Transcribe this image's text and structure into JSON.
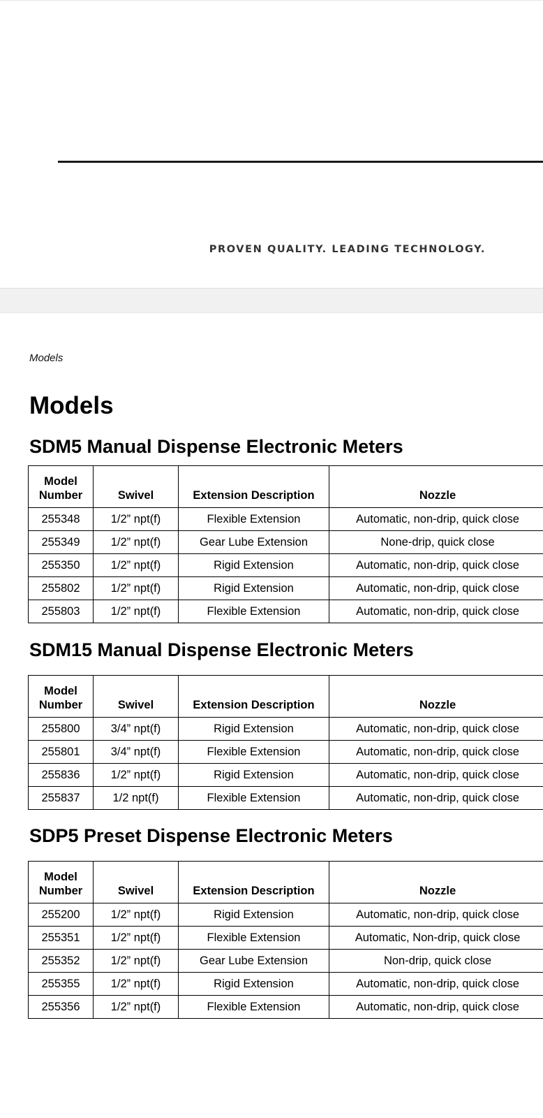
{
  "header": {
    "tagline": "PROVEN QUALITY. LEADING TECHNOLOGY."
  },
  "breadcrumb": "Models",
  "page_title": "Models",
  "columns": {
    "model_number": "Model Number",
    "swivel": "Swivel",
    "extension": "Extension Description",
    "nozzle": "Nozzle"
  },
  "sections": [
    {
      "title": "SDM5 Manual Dispense Electronic Meters",
      "rows": [
        [
          "255348",
          "1/2” npt(f)",
          "Flexible Extension",
          "Automatic, non-drip, quick close"
        ],
        [
          "255349",
          "1/2” npt(f)",
          "Gear Lube Extension",
          "None-drip, quick close"
        ],
        [
          "255350",
          "1/2” npt(f)",
          "Rigid Extension",
          "Automatic, non-drip, quick close"
        ],
        [
          "255802",
          "1/2” npt(f)",
          "Rigid Extension",
          "Automatic, non-drip, quick close"
        ],
        [
          "255803",
          "1/2” npt(f)",
          "Flexible Extension",
          "Automatic, non-drip, quick close"
        ]
      ]
    },
    {
      "title": "SDM15 Manual Dispense Electronic Meters",
      "rows": [
        [
          "255800",
          "3/4” npt(f)",
          "Rigid Extension",
          "Automatic, non-drip, quick close"
        ],
        [
          "255801",
          "3/4” npt(f)",
          "Flexible Extension",
          "Automatic, non-drip, quick close"
        ],
        [
          "255836",
          "1/2” npt(f)",
          "Rigid Extension",
          "Automatic, non-drip, quick close"
        ],
        [
          "255837",
          "1/2 npt(f)",
          "Flexible Extension",
          "Automatic, non-drip, quick close"
        ]
      ]
    },
    {
      "title": "SDP5 Preset Dispense Electronic Meters",
      "rows": [
        [
          "255200",
          "1/2” npt(f)",
          "Rigid Extension",
          "Automatic, non-drip, quick close"
        ],
        [
          "255351",
          "1/2” npt(f)",
          "Flexible Extension",
          "Automatic, Non-drip, quick close"
        ],
        [
          "255352",
          "1/2” npt(f)",
          "Gear Lube Extension",
          "Non-drip, quick close"
        ],
        [
          "255355",
          "1/2” npt(f)",
          "Rigid Extension",
          "Automatic, non-drip, quick close"
        ],
        [
          "255356",
          "1/2” npt(f)",
          "Flexible Extension",
          "Automatic, non-drip, quick close"
        ]
      ]
    }
  ]
}
